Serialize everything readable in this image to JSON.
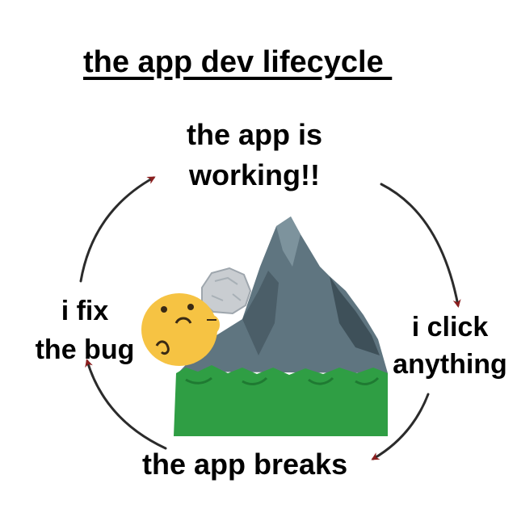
{
  "title": "the app dev lifecycle ",
  "states": {
    "top": [
      "the app is",
      "working!!"
    ],
    "right": [
      "i click",
      "anything"
    ],
    "bottom": "the app breaks",
    "left": [
      "i fix",
      "the bug"
    ]
  },
  "icons": {
    "cycle": "cycle-arrows-icon",
    "mountain": "mountain-icon",
    "boulder": "rock-icon",
    "face": "pushing-face-emoji-icon"
  },
  "colors": {
    "arrow_line": "#2b2b2b",
    "arrow_head": "#8b1e1e",
    "mountain": "#5f7580",
    "grass": "#2f9e44",
    "face": "#f6c343"
  }
}
